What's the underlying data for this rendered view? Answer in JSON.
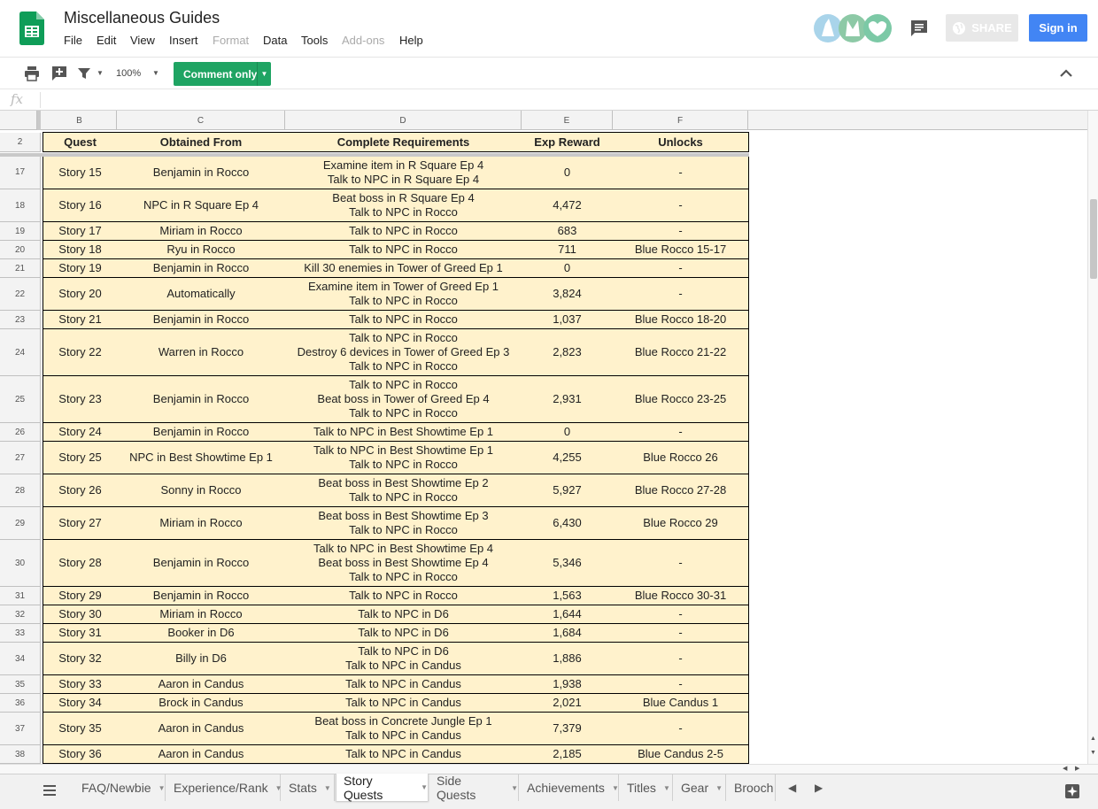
{
  "app": {
    "title": "Miscellaneous Guides",
    "menus": [
      "File",
      "Edit",
      "View",
      "Insert",
      "Format",
      "Data",
      "Tools",
      "Add-ons",
      "Help"
    ],
    "disabled_menus": [
      "Format",
      "Add-ons"
    ],
    "share_label": "SHARE",
    "signin_label": "Sign in"
  },
  "toolbar": {
    "zoom": "100%",
    "comment_only_label": "Comment only"
  },
  "formula_bar": {
    "fx_label": "fx",
    "value": ""
  },
  "columns": [
    {
      "letter": "B"
    },
    {
      "letter": "C"
    },
    {
      "letter": "D"
    },
    {
      "letter": "E"
    },
    {
      "letter": "F"
    }
  ],
  "header_row": {
    "num": "2",
    "cells": [
      "Quest",
      "Obtained From",
      "Complete Requirements",
      "Exp Reward",
      "Unlocks"
    ]
  },
  "rows": [
    {
      "num": "17",
      "cells": [
        "Story 15",
        "Benjamin in Rocco",
        "Examine item in R Square Ep 4\nTalk to NPC in R Square Ep 4",
        "0",
        "-"
      ]
    },
    {
      "num": "18",
      "cells": [
        "Story 16",
        "NPC in R Square Ep 4",
        "Beat boss in R Square Ep 4\nTalk to NPC in Rocco",
        "4,472",
        "-"
      ]
    },
    {
      "num": "19",
      "cells": [
        "Story 17",
        "Miriam in Rocco",
        "Talk to NPC in Rocco",
        "683",
        "-"
      ]
    },
    {
      "num": "20",
      "cells": [
        "Story 18",
        "Ryu in Rocco",
        "Talk to NPC in Rocco",
        "711",
        "Blue Rocco 15-17"
      ]
    },
    {
      "num": "21",
      "cells": [
        "Story 19",
        "Benjamin in Rocco",
        "Kill 30 enemies in Tower of Greed Ep 1",
        "0",
        "-"
      ]
    },
    {
      "num": "22",
      "cells": [
        "Story 20",
        "Automatically",
        "Examine item in Tower of Greed Ep 1\nTalk to NPC in Rocco",
        "3,824",
        "-"
      ]
    },
    {
      "num": "23",
      "cells": [
        "Story 21",
        "Benjamin in Rocco",
        "Talk to NPC in Rocco",
        "1,037",
        "Blue Rocco 18-20"
      ]
    },
    {
      "num": "24",
      "cells": [
        "Story 22",
        "Warren in Rocco",
        "Talk to NPC in Rocco\nDestroy 6 devices in Tower of Greed Ep 3\nTalk to NPC in Rocco",
        "2,823",
        "Blue Rocco 21-22"
      ]
    },
    {
      "num": "25",
      "cells": [
        "Story 23",
        "Benjamin in Rocco",
        "Talk to NPC in Rocco\nBeat boss in Tower of Greed Ep 4\nTalk to NPC in Rocco",
        "2,931",
        "Blue Rocco 23-25"
      ]
    },
    {
      "num": "26",
      "cells": [
        "Story 24",
        "Benjamin in Rocco",
        "Talk to NPC in Best Showtime Ep 1",
        "0",
        "-"
      ]
    },
    {
      "num": "27",
      "cells": [
        "Story 25",
        "NPC in Best Showtime Ep 1",
        "Talk to NPC in Best Showtime Ep 1\nTalk to NPC in Rocco",
        "4,255",
        "Blue Rocco 26"
      ]
    },
    {
      "num": "28",
      "cells": [
        "Story 26",
        "Sonny in Rocco",
        "Beat boss in Best Showtime Ep 2\nTalk to NPC in Rocco",
        "5,927",
        "Blue Rocco 27-28"
      ]
    },
    {
      "num": "29",
      "cells": [
        "Story 27",
        "Miriam in Rocco",
        "Beat boss in Best Showtime Ep 3\nTalk to NPC in Rocco",
        "6,430",
        "Blue Rocco 29"
      ]
    },
    {
      "num": "30",
      "cells": [
        "Story 28",
        "Benjamin in Rocco",
        "Talk to NPC in Best Showtime Ep 4\nBeat boss in Best Showtime Ep 4\nTalk to NPC in Rocco",
        "5,346",
        "-"
      ]
    },
    {
      "num": "31",
      "cells": [
        "Story 29",
        "Benjamin in Rocco",
        "Talk to NPC in Rocco",
        "1,563",
        "Blue Rocco 30-31"
      ]
    },
    {
      "num": "32",
      "cells": [
        "Story 30",
        "Miriam in Rocco",
        "Talk to NPC in D6",
        "1,644",
        "-"
      ]
    },
    {
      "num": "33",
      "cells": [
        "Story 31",
        "Booker in D6",
        "Talk to NPC in D6",
        "1,684",
        "-"
      ]
    },
    {
      "num": "34",
      "cells": [
        "Story 32",
        "Billy in D6",
        "Talk to NPC in D6\nTalk to NPC in Candus",
        "1,886",
        "-"
      ]
    },
    {
      "num": "35",
      "cells": [
        "Story 33",
        "Aaron in Candus",
        "Talk to NPC in Candus",
        "1,938",
        "-"
      ]
    },
    {
      "num": "36",
      "cells": [
        "Story 34",
        "Brock in Candus",
        "Talk to NPC in Candus",
        "2,021",
        "Blue Candus 1"
      ]
    },
    {
      "num": "37",
      "cells": [
        "Story 35",
        "Aaron in Candus",
        "Beat boss in Concrete Jungle Ep 1\nTalk to NPC in Candus",
        "7,379",
        "-"
      ]
    },
    {
      "num": "38",
      "cells": [
        "Story 36",
        "Aaron in Candus",
        "Talk to NPC in Candus",
        "2,185",
        "Blue Candus 2-5"
      ]
    }
  ],
  "tabs": [
    {
      "label": "FAQ/Newbie",
      "active": false
    },
    {
      "label": "Experience/Rank",
      "active": false
    },
    {
      "label": "Stats",
      "active": false
    },
    {
      "label": "Story Quests",
      "active": true
    },
    {
      "label": "Side Quests",
      "active": false
    },
    {
      "label": "Achievements",
      "active": false
    },
    {
      "label": "Titles",
      "active": false
    },
    {
      "label": "Gear",
      "active": false
    },
    {
      "label": "Brooch",
      "active": false
    }
  ],
  "colors": {
    "cell_fill": "#fff2cc",
    "comment_only": "#1fa463",
    "signin": "#4285f4"
  }
}
